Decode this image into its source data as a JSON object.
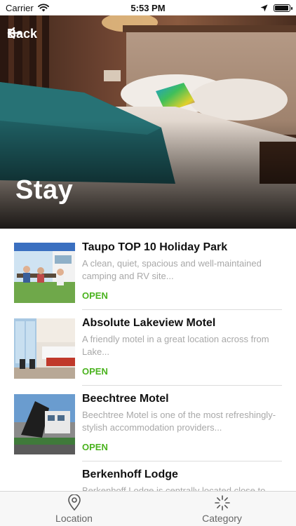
{
  "status_bar": {
    "carrier": "Carrier",
    "time": "5:53 PM",
    "battery_level": 0.95
  },
  "header": {
    "back_label": "Back",
    "title": "Stay"
  },
  "listings": [
    {
      "title": "Taupo TOP 10 Holiday Park",
      "description": "A clean, quiet, spacious and well-maintained camping and RV site...",
      "status": "OPEN"
    },
    {
      "title": "Absolute Lakeview Motel",
      "description": "A friendly motel in a great location across from Lake...",
      "status": "OPEN"
    },
    {
      "title": "Beechtree Motel",
      "description": "Beechtree Motel is one of the most refreshingly-stylish accommodation providers...",
      "status": "OPEN"
    },
    {
      "title": "Berkenhoff Lodge",
      "description": "Berkenhoff Lodge is centrally located close to...",
      "status": ""
    }
  ],
  "tab_bar": {
    "tabs": [
      {
        "label": "Location",
        "icon": "map-pin-icon"
      },
      {
        "label": "Category",
        "icon": "loading-spinner-icon"
      }
    ]
  },
  "colors": {
    "open_status": "#4bb31f",
    "description_text": "#a8a8a8"
  }
}
